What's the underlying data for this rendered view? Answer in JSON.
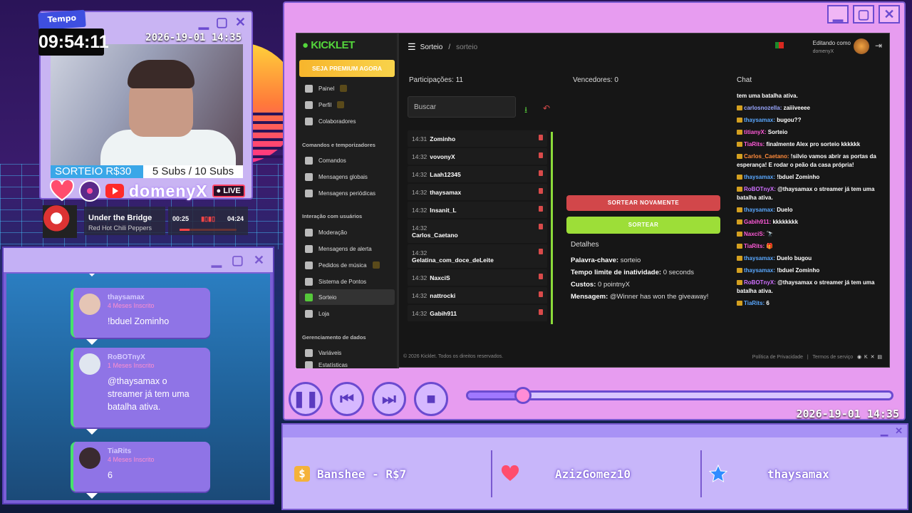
{
  "overlay": {
    "tempo_label": "Tempo",
    "clock": "09:54:11",
    "date": "2026-19-01 14:35",
    "sub_goal_left": "SORTEIO R$30",
    "sub_goal_right": "5 Subs / 10 Subs",
    "streamer_name": "domenyX",
    "live_badge": "LIVE"
  },
  "music": {
    "title": "Under the Bridge",
    "artist": "Red Hot Chili Peppers",
    "current": "00:25",
    "total": "04:24",
    "progress": 0.18
  },
  "chat_overlay": [
    {
      "user": "thaysamax",
      "sub": "4 Meses Inscrito",
      "message": "!bduel Zominho"
    },
    {
      "user": "RoBOTnyX",
      "sub": "1 Meses Inscrito",
      "message": "@thaysamax o streamer já tem uma batalha ativa."
    },
    {
      "user": "TiaRits",
      "sub": "4 Meses Inscrito",
      "message": "6"
    }
  ],
  "app": {
    "brand": "KICKLET",
    "premium_button": "SEJA PREMIUM AGORA",
    "sidebar": [
      {
        "label": "Painel",
        "icon": "grid-icon"
      },
      {
        "label": "Perfil",
        "icon": "user-icon"
      },
      {
        "label": "Colaboradores",
        "icon": "handshake-icon"
      }
    ],
    "section_commands": "Comandos e temporizadores",
    "sidebar_commands": [
      {
        "label": "Comandos",
        "icon": "wand-icon"
      },
      {
        "label": "Mensagens globais",
        "icon": "message-icon"
      },
      {
        "label": "Mensagens periódicas",
        "icon": "clock-icon"
      }
    ],
    "section_interaction": "Interação com usuários",
    "sidebar_interaction": [
      {
        "label": "Moderação",
        "icon": "shield-icon"
      },
      {
        "label": "Mensagens de alerta",
        "icon": "megaphone-icon"
      },
      {
        "label": "Pedidos de música",
        "icon": "music-icon"
      },
      {
        "label": "Sistema de Pontos",
        "icon": "star-icon"
      },
      {
        "label": "Sorteio",
        "icon": "gift-icon"
      },
      {
        "label": "Loja",
        "icon": "cart-icon"
      }
    ],
    "section_data": "Gerenciamento de dados",
    "sidebar_data": [
      {
        "label": "Variáveis",
        "icon": "link-icon"
      },
      {
        "label": "Estatísticas",
        "icon": "chart-icon"
      }
    ],
    "breadcrumb_main": "Sorteio",
    "breadcrumb_sep": "/",
    "breadcrumb_sub": "sorteio",
    "editing_label": "Editando como",
    "editing_user": "domenyX",
    "participants_header": "Participações: 11",
    "search_placeholder": "Buscar",
    "participants": [
      {
        "time": "14:31",
        "name": "Zominho"
      },
      {
        "time": "14:32",
        "name": "vovonyX"
      },
      {
        "time": "14:32",
        "name": "Laah12345"
      },
      {
        "time": "14:32",
        "name": "thaysamax"
      },
      {
        "time": "14:32",
        "name": "Insanit_L"
      },
      {
        "time": "14:32",
        "name": "Carlos_Caetano"
      },
      {
        "time": "14:32",
        "name": "Gelatina_com_doce_deLeite"
      },
      {
        "time": "14:32",
        "name": "NaxciS"
      },
      {
        "time": "14:32",
        "name": "nattrocki"
      },
      {
        "time": "14:32",
        "name": "Gabih911"
      }
    ],
    "winners_header": "Vencedores: 0",
    "btn_again": "SORTEAR NOVAMENTE",
    "btn_draw": "SORTEAR",
    "details_header": "Detalhes",
    "details": {
      "keyword_label": "Palavra-chave:",
      "keyword": "sorteio",
      "timeout_label": "Tempo limite de inatividade:",
      "timeout": "0 seconds",
      "cost_label": "Custos:",
      "cost": "0 pointnyX",
      "message_label": "Mensagem:",
      "message": "@Winner has won the giveaway!"
    },
    "chat_header": "Chat",
    "chat": [
      {
        "user": "",
        "text": "tem uma batalha ativa.",
        "color": "#ffffff"
      },
      {
        "user": "carlosnozella:",
        "text": "zaiiiveeee",
        "color": "#9aa7ff"
      },
      {
        "user": "thaysamax:",
        "text": "bugou??",
        "color": "#5aa8ff"
      },
      {
        "user": "titianyX:",
        "text": "Sorteio",
        "color": "#ff5ad8"
      },
      {
        "user": "TiaRits:",
        "text": "finalmente Alex pro sorteio kkkkkk",
        "color": "#ff5ad8"
      },
      {
        "user": "Carlos_Caetano:",
        "text": "!silvio vamos abrir as portas da esperança! E rodar o peão da casa própria!",
        "color": "#ff8a3a"
      },
      {
        "user": "thaysamax:",
        "text": "!bduel Zominho",
        "color": "#5aa8ff"
      },
      {
        "user": "RoBOTnyX:",
        "text": "@thaysamax o streamer já tem uma batalha ativa.",
        "color": "#d070ff"
      },
      {
        "user": "thaysamax:",
        "text": "Duelo",
        "color": "#5aa8ff"
      },
      {
        "user": "Gabih911:",
        "text": "kkkkkkkk",
        "color": "#ff5ad8"
      },
      {
        "user": "NaxciS:",
        "text": "🔭",
        "color": "#ff5ad8"
      },
      {
        "user": "TiaRits:",
        "text": "🎁",
        "color": "#ff5ad8"
      },
      {
        "user": "thaysamax:",
        "text": "Duelo bugou",
        "color": "#5aa8ff"
      },
      {
        "user": "thaysamax:",
        "text": "!bduel Zominho",
        "color": "#5aa8ff"
      },
      {
        "user": "RoBOTnyX:",
        "text": "@thaysamax o streamer já tem uma batalha ativa.",
        "color": "#d070ff"
      },
      {
        "user": "TiaRits:",
        "text": "6",
        "color": "#5aa8ff"
      }
    ],
    "footer_left": "© 2026 Kicklet. Todos os direitos reservados.",
    "footer_privacy": "Política de Privacidade",
    "footer_sep": "|",
    "footer_terms": "Termos de serviço"
  },
  "player": {
    "time": "2026-19-01 14:35",
    "seek_progress": 0.13
  },
  "alerts": {
    "donation": "Banshee - R$7",
    "follower": "AzizGomez10",
    "sub": "thaysamax"
  }
}
